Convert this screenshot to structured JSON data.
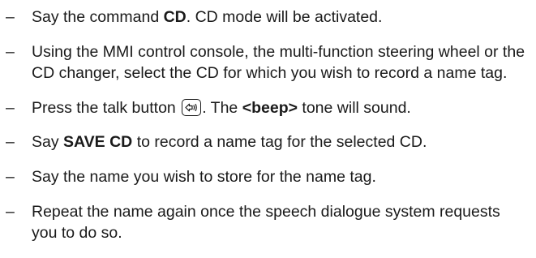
{
  "steps": [
    {
      "dash": "–",
      "parts": [
        {
          "t": "Say the command "
        },
        {
          "t": "CD",
          "b": true
        },
        {
          "t": ". CD mode will be activated."
        }
      ]
    },
    {
      "dash": "–",
      "parts": [
        {
          "t": "Using the MMI control console, the multi-function steering wheel or the CD changer, select the CD for which you wish to record a name tag."
        }
      ]
    },
    {
      "dash": "–",
      "parts": [
        {
          "t": "Press the talk button "
        },
        {
          "icon": "talk-button-icon"
        },
        {
          "t": ". The "
        },
        {
          "t": "<beep>",
          "b": true
        },
        {
          "t": " tone will sound."
        }
      ]
    },
    {
      "dash": "–",
      "parts": [
        {
          "t": "Say "
        },
        {
          "t": "SAVE CD",
          "b": true
        },
        {
          "t": " to record a name tag for the selected CD."
        }
      ]
    },
    {
      "dash": "–",
      "parts": [
        {
          "t": "Say the name you wish to store for the name tag."
        }
      ]
    },
    {
      "dash": "–",
      "parts": [
        {
          "t": "Repeat the name again once the speech dialogue system requests you to do so."
        }
      ]
    }
  ]
}
